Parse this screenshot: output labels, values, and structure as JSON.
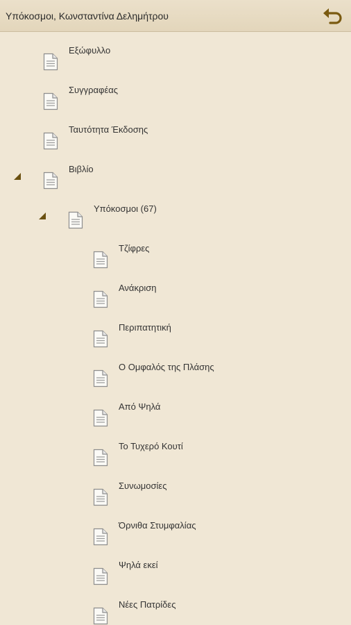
{
  "header": {
    "title": "Υπόκοσμοι, Κωνσταντίνα Δελημήτρου",
    "back_icon": "undo-arrow-icon",
    "accent_color": "#7a5a10"
  },
  "tree": {
    "items": [
      {
        "label": "Εξώφυλλο",
        "level": 0,
        "expander": null,
        "icon": "document-icon"
      },
      {
        "label": "Συγγραφέας",
        "level": 0,
        "expander": null,
        "icon": "document-icon"
      },
      {
        "label": "Ταυτότητα Έκδοσης",
        "level": 0,
        "expander": null,
        "icon": "document-icon"
      },
      {
        "label": "Βιβλίο",
        "level": 0,
        "expander": "expanded",
        "icon": "document-icon"
      },
      {
        "label": "Υπόκοσμοι (67)",
        "level": 1,
        "expander": "expanded",
        "icon": "document-icon"
      },
      {
        "label": "Τζίφρες",
        "level": 2,
        "expander": null,
        "icon": "document-icon"
      },
      {
        "label": "Ανάκριση",
        "level": 2,
        "expander": null,
        "icon": "document-icon"
      },
      {
        "label": "Περιπατητική",
        "level": 2,
        "expander": null,
        "icon": "document-icon"
      },
      {
        "label": "Ο Ομφαλός της Πλάσης",
        "level": 2,
        "expander": null,
        "icon": "document-icon"
      },
      {
        "label": "Από Ψηλά",
        "level": 2,
        "expander": null,
        "icon": "document-icon"
      },
      {
        "label": "Το Τυχερό Κουτί",
        "level": 2,
        "expander": null,
        "icon": "document-icon"
      },
      {
        "label": "Συνωμοσίες",
        "level": 2,
        "expander": null,
        "icon": "document-icon"
      },
      {
        "label": "Όρνιθα Στυμφαλίας",
        "level": 2,
        "expander": null,
        "icon": "document-icon"
      },
      {
        "label": "Ψηλά εκεί",
        "level": 2,
        "expander": null,
        "icon": "document-icon"
      },
      {
        "label": "Νέες Πατρίδες",
        "level": 2,
        "expander": null,
        "icon": "document-icon"
      }
    ]
  }
}
